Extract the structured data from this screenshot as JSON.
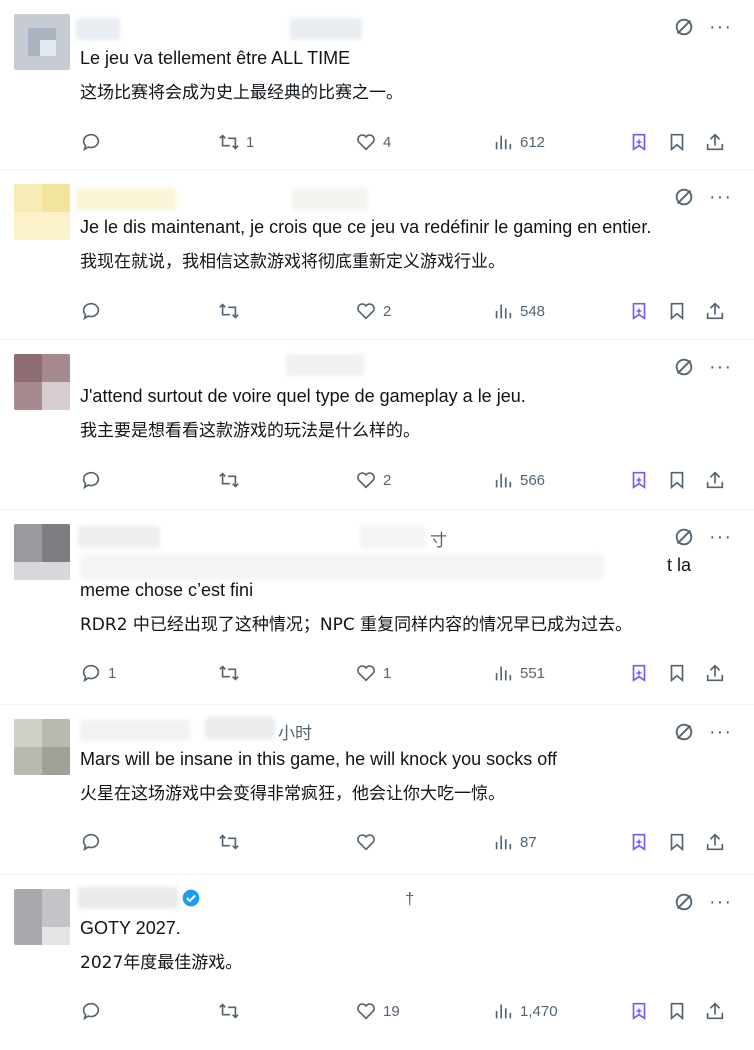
{
  "tweets": [
    {
      "text_fr": "Le jeu va tellement être ALL TIME",
      "text_cn": "这场比赛将会成为史上最经典的比赛之一。",
      "replies": "",
      "retweets": "1",
      "likes": "4",
      "views": "612"
    },
    {
      "text_fr": "Je le dis maintenant, je crois que ce jeu va redéfinir le gaming en entier.",
      "text_cn": "我现在就说，我相信这款游戏将彻底重新定义游戏行业。",
      "replies": "",
      "retweets": "",
      "likes": "2",
      "views": "548"
    },
    {
      "text_fr": "J'attend surtout de voire quel type de gameplay a le jeu.",
      "text_cn": "我主要是想看看这款游戏的玩法是什么样的。",
      "replies": "",
      "retweets": "",
      "likes": "2",
      "views": "566"
    },
    {
      "header_fragment": "寸",
      "text_fr_fragment": "t la",
      "text_fr": "meme chose c’est fini",
      "text_cn": "RDR2 中已经出现了这种情况；NPC 重复同样内容的情况早已成为过去。",
      "replies": "1",
      "retweets": "",
      "likes": "1",
      "views": "551"
    },
    {
      "header_fragment": "小时",
      "text_fr": "Mars will be insane in this game, he will knock you socks off",
      "text_cn": "火星在这场游戏中会变得非常疯狂，他会让你大吃一惊。",
      "replies": "",
      "retweets": "",
      "likes": "",
      "views": "87"
    },
    {
      "header_fragment": "†",
      "text_fr": "GOTY 2027.",
      "text_cn": "2027年度最佳游戏。",
      "replies": "",
      "retweets": "",
      "likes": "",
      "replies_count": "19",
      "views": "1,470"
    }
  ],
  "icons": {
    "reply": "reply-icon",
    "retweet": "retweet-icon",
    "like": "heart-icon",
    "views": "views-icon",
    "grok": "grok-icon",
    "bookmark": "bookmark-icon",
    "share": "share-icon",
    "more": "more-icon",
    "verified": "verified-badge-icon"
  },
  "more_glyph": "···",
  "colors": {
    "text": "#0f1419",
    "secondary": "#536471",
    "grok": "#7856ff",
    "verified": "#1d9bf0"
  }
}
